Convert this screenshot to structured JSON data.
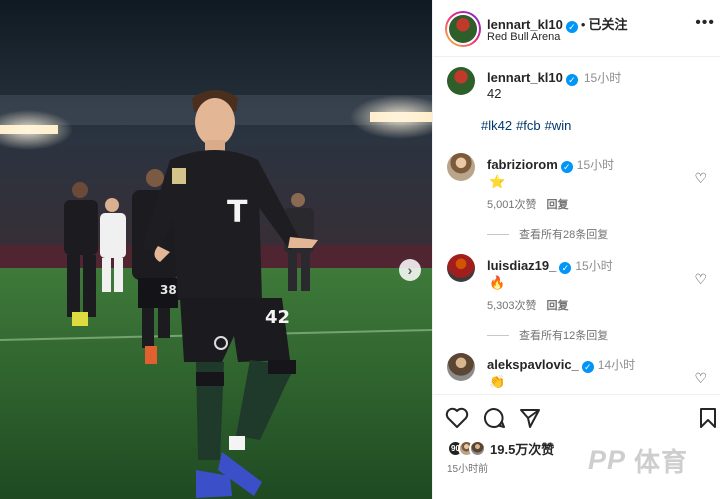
{
  "header": {
    "username": "lennart_kl10",
    "follow_label": "已关注",
    "dot": "•",
    "location": "Red Bull Arena",
    "more_icon": "more-horizontal-icon"
  },
  "caption": {
    "username": "lennart_kl10",
    "time": "15小时",
    "text": "42",
    "hashtags": [
      "#lk42",
      "#fcb",
      "#win"
    ]
  },
  "comments": [
    {
      "username": "fabriziorom",
      "time": "15小时",
      "emoji": "⭐",
      "likes": "5,001次赞",
      "reply": "回复",
      "view_replies": "查看所有28条回复"
    },
    {
      "username": "luisdiaz19_",
      "time": "15小时",
      "emoji": "🔥",
      "likes": "5,303次赞",
      "reply": "回复",
      "view_replies": "查看所有12条回复"
    },
    {
      "username": "alekspavlovic_",
      "time": "14小时",
      "emoji": "👏"
    }
  ],
  "photo": {
    "jersey_number": "42",
    "bg_number": "38",
    "sponsor": "T"
  },
  "footer": {
    "likes": "19.5万次赞",
    "time_ago": "15小时前",
    "mini_avatar_label": "90"
  },
  "watermark": {
    "logo": "PP",
    "text": "体育"
  },
  "colors": {
    "verified": "#0095f6",
    "link": "#00376b",
    "muted": "#737373"
  }
}
